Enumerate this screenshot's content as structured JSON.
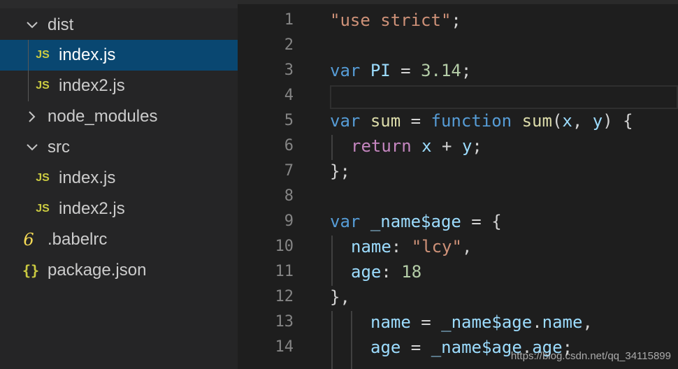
{
  "explorer": {
    "items": [
      {
        "name": "dist",
        "icon": "chevron-down"
      },
      {
        "name": "index.js",
        "icon": "JS"
      },
      {
        "name": "index2.js",
        "icon": "JS"
      },
      {
        "name": "node_modules",
        "icon": "chevron-right"
      },
      {
        "name": "src",
        "icon": "chevron-down"
      },
      {
        "name": "index.js",
        "icon": "JS"
      },
      {
        "name": "index2.js",
        "icon": "JS"
      },
      {
        "name": ".babelrc",
        "icon": "6"
      },
      {
        "name": "package.json",
        "icon": "{}"
      }
    ],
    "selected": "index.js",
    "colors": {
      "js_icon": "#cbcb41",
      "json_icon": "#cbcb41",
      "babel_icon": "#f5da55",
      "selected_bg": "#094771"
    }
  },
  "editor": {
    "line_numbers": [
      "1",
      "2",
      "3",
      "4",
      "5",
      "6",
      "7",
      "8",
      "9",
      "10",
      "11",
      "12",
      "13",
      "14"
    ],
    "code": {
      "l1": {
        "s": "\"use strict\"",
        "p": ";"
      },
      "l3": {
        "k": "var",
        "v": "PI",
        "o": " = ",
        "n": "3.14",
        "p": ";"
      },
      "l5": {
        "k": "var",
        "v": "sum",
        "o": " = ",
        "k2": "function",
        "f": "sum",
        "p1": "(",
        "a": "x",
        "c": ", ",
        "b": "y",
        "p2": ") {"
      },
      "l6": {
        "k": "return",
        "a": "x",
        "o": " + ",
        "b": "y",
        "p": ";"
      },
      "l7": {
        "p": "};"
      },
      "l9": {
        "k": "var",
        "v": "_name$age",
        "o": " = {"
      },
      "l10": {
        "k": "name",
        "o": ": ",
        "s": "\"lcy\"",
        "p": ","
      },
      "l11": {
        "k": "age",
        "o": ": ",
        "n": "18"
      },
      "l12": {
        "p": "},"
      },
      "l13": {
        "v": "name",
        "o": " = ",
        "v2": "_name$age",
        "d": ".",
        "v3": "name",
        "p": ","
      },
      "l14": {
        "v": "age",
        "o": " = ",
        "v2": "_name$age",
        "d": ".",
        "v3": "age",
        "p": ";"
      }
    },
    "colors": {
      "string": "#ce9178",
      "keyword": "#569cd6",
      "control": "#c586c0",
      "variable": "#9cdcfe",
      "number": "#b5cea8",
      "function": "#dcdcaa"
    }
  },
  "watermark": "https://blog.csdn.net/qq_34115899"
}
